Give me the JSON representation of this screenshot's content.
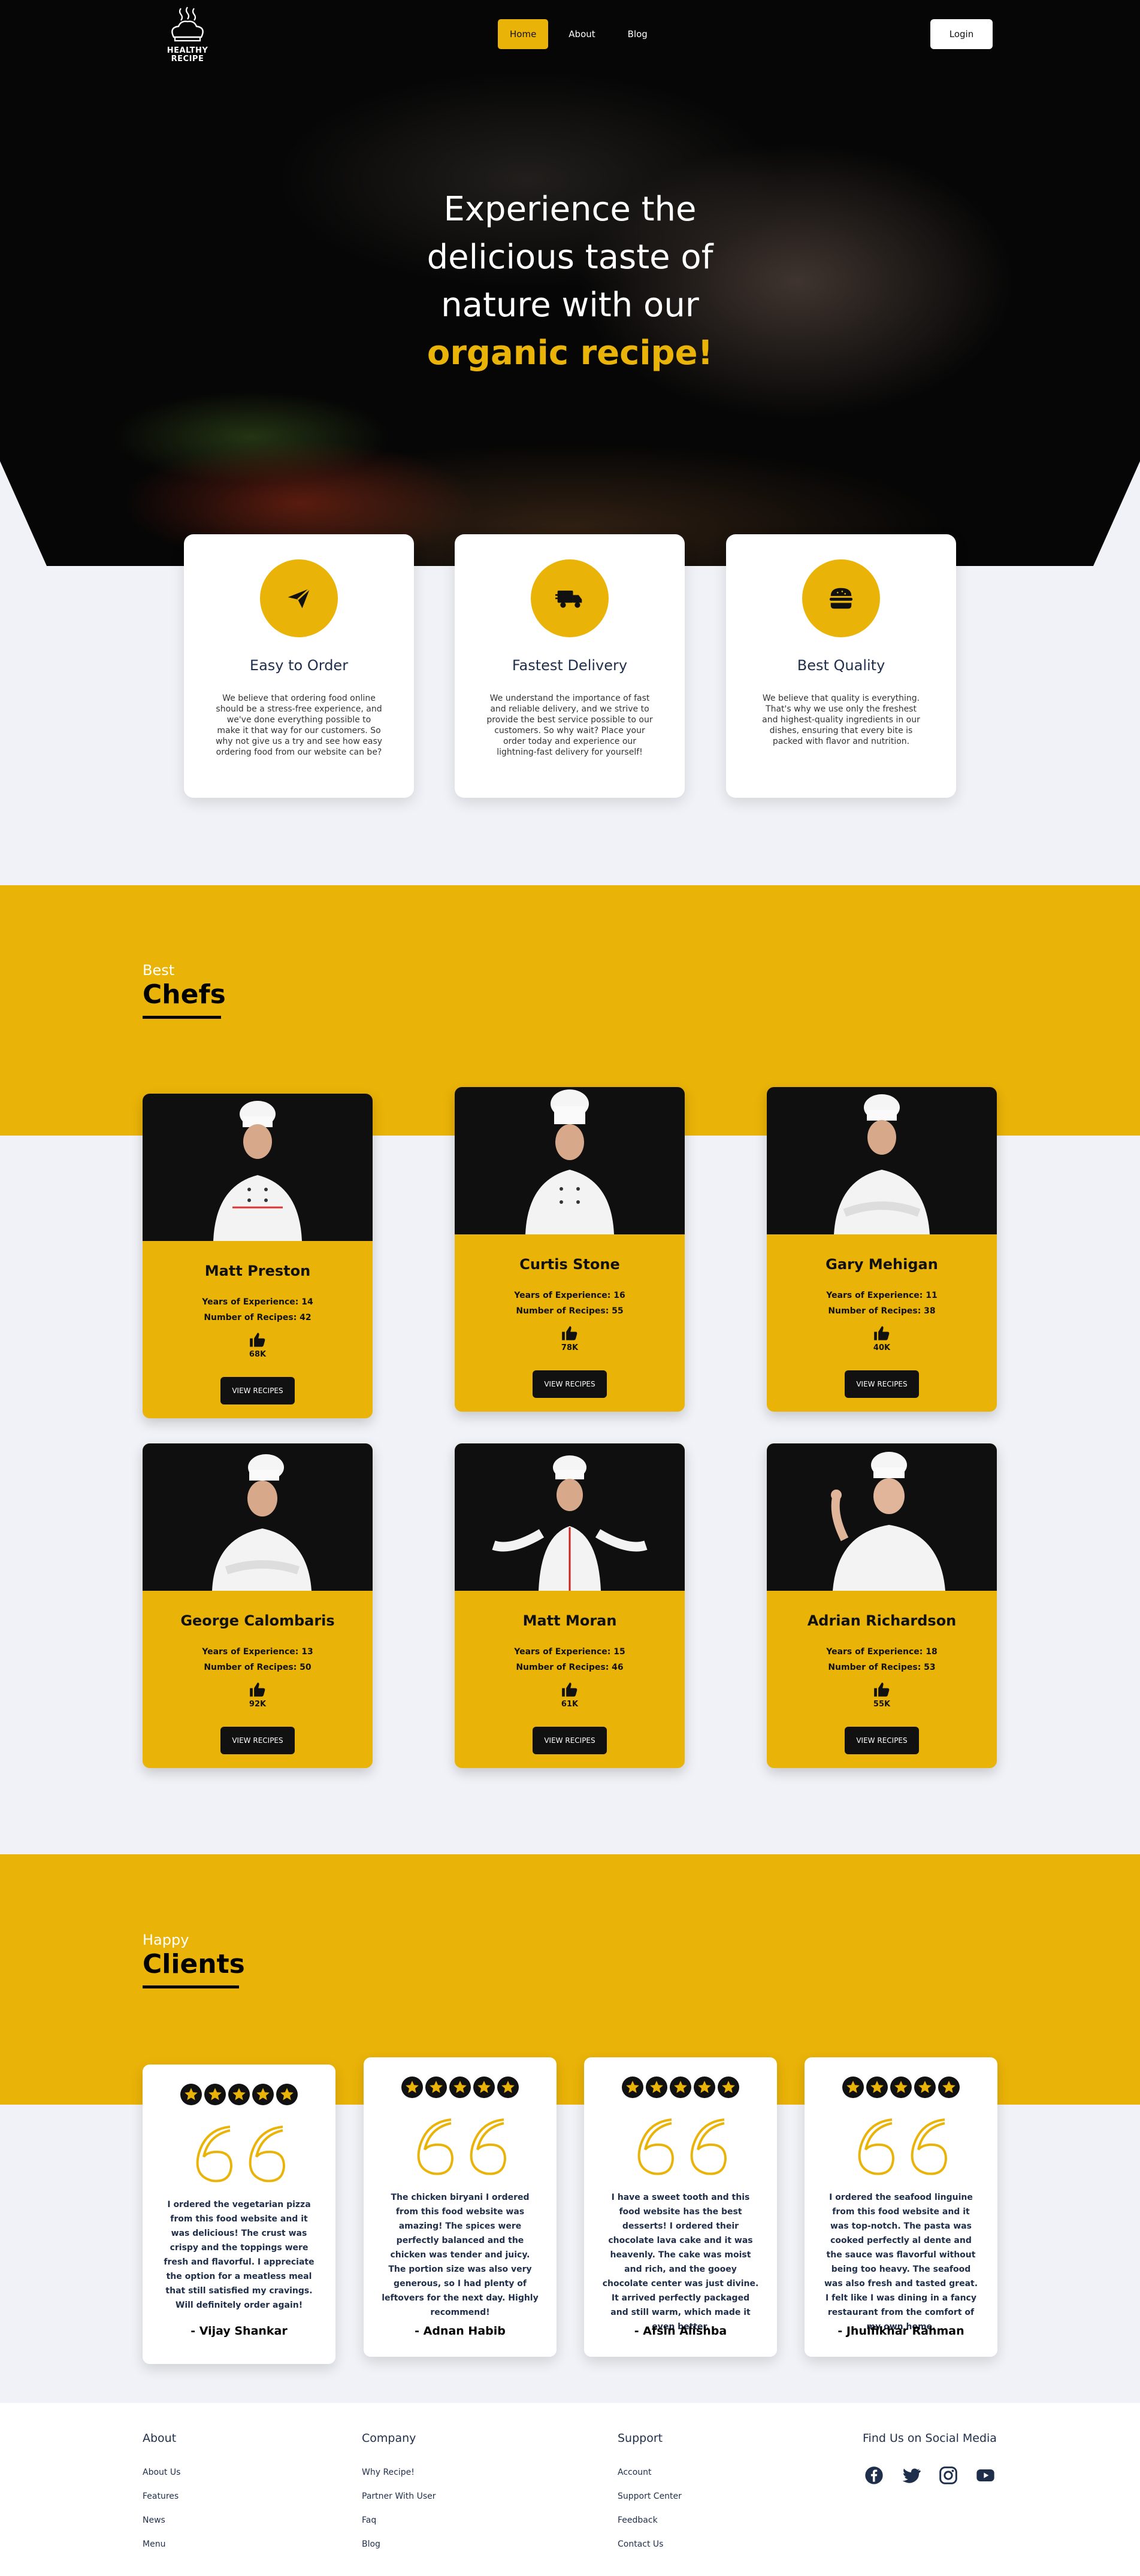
{
  "brand": {
    "logo_line1": "HEALTHY",
    "logo_line2": "RECIPE"
  },
  "nav": {
    "items": [
      "Home",
      "About",
      "Blog"
    ],
    "active": "Home",
    "login_label": "Login"
  },
  "hero": {
    "line1": "Experience the",
    "line2": "delicious taste of",
    "line3": "nature with our",
    "highlight": "organic recipe!"
  },
  "features": [
    {
      "icon": "paper-plane-icon",
      "title": "Easy to Order",
      "text": "We believe that ordering food online should be a stress-free experience, and we've done everything possible to make it that way for our customers. So why not give us a try and see how easy ordering food from our website can be?"
    },
    {
      "icon": "delivery-truck-icon",
      "title": "Fastest Delivery",
      "text": "We understand the importance of fast and reliable delivery, and we strive to provide the best service possible to our customers. So why wait? Place your order today and experience our lightning-fast delivery for yourself!"
    },
    {
      "icon": "burger-icon",
      "title": "Best Quality",
      "text": "We believe that quality is everything. That's why we use only the freshest and highest-quality ingredients in our dishes, ensuring that every bite is packed with flavor and nutrition."
    }
  ],
  "chefs_section": {
    "subtitle": "Best",
    "title": "Chefs"
  },
  "chefs": [
    {
      "name": "Matt Preston",
      "experience": "Years of Experience: 14",
      "recipes": "Number of Recipes: 42",
      "likes": "68K",
      "button": "VIEW RECIPES"
    },
    {
      "name": "Curtis Stone",
      "experience": "Years of Experience: 16",
      "recipes": "Number of Recipes: 55",
      "likes": "78K",
      "button": "VIEW RECIPES"
    },
    {
      "name": "Gary Mehigan",
      "experience": "Years of Experience: 11",
      "recipes": "Number of Recipes: 38",
      "likes": "40K",
      "button": "VIEW RECIPES"
    },
    {
      "name": "George Calombaris",
      "experience": "Years of Experience: 13",
      "recipes": "Number of Recipes: 50",
      "likes": "92K",
      "button": "VIEW RECIPES"
    },
    {
      "name": "Matt Moran",
      "experience": "Years of Experience: 15",
      "recipes": "Number of Recipes: 46",
      "likes": "61K",
      "button": "VIEW RECIPES"
    },
    {
      "name": "Adrian Richardson",
      "experience": "Years of Experience: 18",
      "recipes": "Number of Recipes: 53",
      "likes": "55K",
      "button": "VIEW RECIPES"
    }
  ],
  "clients_section": {
    "subtitle": "Happy",
    "title": "Clients"
  },
  "testimonials": [
    {
      "rating": 5,
      "text": "I ordered the vegetarian pizza from this food website and it was delicious! The crust was crispy and the toppings were fresh and flavorful. I appreciate the option for a meatless meal that still satisfied my cravings. Will definitely order again!",
      "author": "- Vijay Shankar"
    },
    {
      "rating": 5,
      "text": "The chicken biryani I ordered from this food website was amazing! The spices were perfectly balanced and the chicken was tender and juicy. The portion size was also very generous, so I had plenty of leftovers for the next day. Highly recommend!",
      "author": "- Adnan Habib"
    },
    {
      "rating": 5,
      "text": "I have a sweet tooth and this food website has the best desserts! I ordered their chocolate lava cake and it was heavenly. The cake was moist and rich, and the gooey chocolate center was just divine. It arrived perfectly packaged and still warm, which made it even better.",
      "author": "- Afsin Alishba"
    },
    {
      "rating": 5,
      "text": "I ordered the seafood linguine from this food website and it was top-notch. The pasta was cooked perfectly al dente and the sauce was flavorful without being too heavy. The seafood was also fresh and tasted great. I felt like I was dining in a fancy restaurant from the comfort of my own home.",
      "author": "- Jhulfikhar Rahman"
    }
  ],
  "footer": {
    "about": {
      "title": "About",
      "links": [
        "About Us",
        "Features",
        "News",
        "Menu"
      ]
    },
    "company": {
      "title": "Company",
      "links": [
        "Why Recipe!",
        "Partner With User",
        "Faq",
        "Blog"
      ]
    },
    "support": {
      "title": "Support",
      "links": [
        "Account",
        "Support Center",
        "Feedback",
        "Contact Us"
      ]
    },
    "social": {
      "title": "Find Us on Social Media",
      "icons": [
        "facebook-icon",
        "twitter-icon",
        "instagram-icon",
        "youtube-icon"
      ]
    }
  },
  "colors": {
    "accent": "#eab308",
    "dark": "#111111",
    "navy_text": "#1f2e4a",
    "page_bg": "#f0f2f7"
  }
}
